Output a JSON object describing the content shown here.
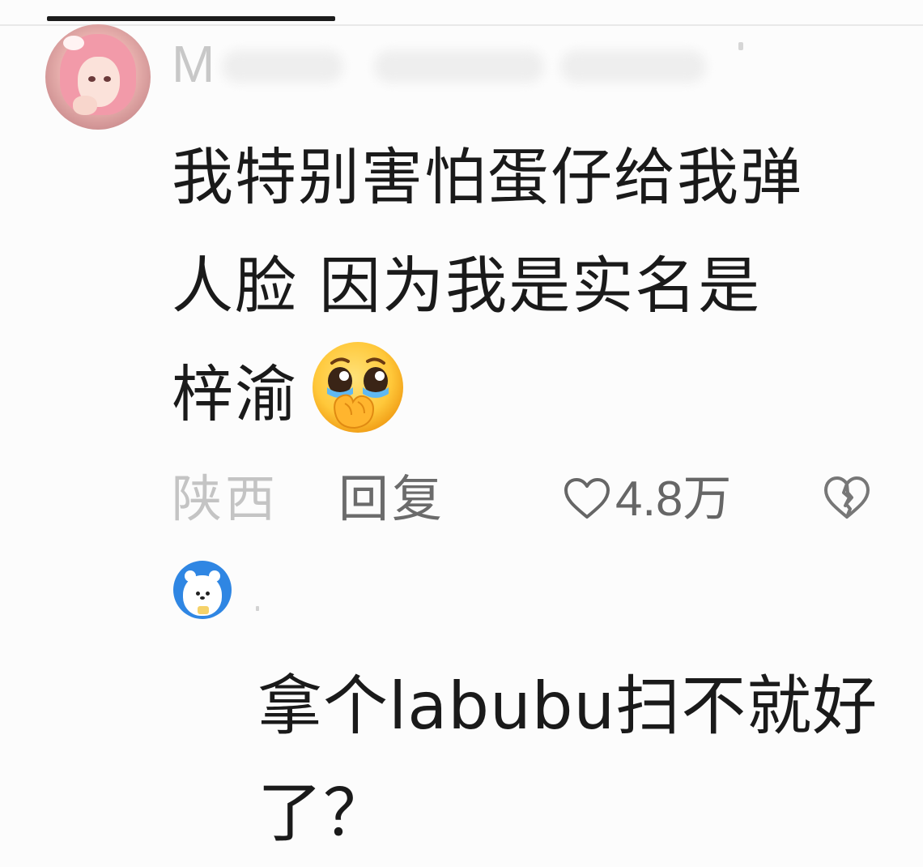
{
  "comment": {
    "username": "M",
    "text_lines": [
      "我特别害怕蛋仔给我弹",
      "人脸 因为我是实名是",
      "梓渝"
    ],
    "emoji": "face-holding-back-tears",
    "location": "陕西",
    "reply_label": "回复",
    "like_count": "4.8万"
  },
  "reply": {
    "text_lines": [
      "拿个labubu扫不就好",
      "了？"
    ]
  },
  "colors": {
    "text": "#1a1a1a",
    "muted": "#c4c4c4",
    "secondary": "#6b6b6b",
    "reply_avatar_bg": "#2f86e3"
  }
}
